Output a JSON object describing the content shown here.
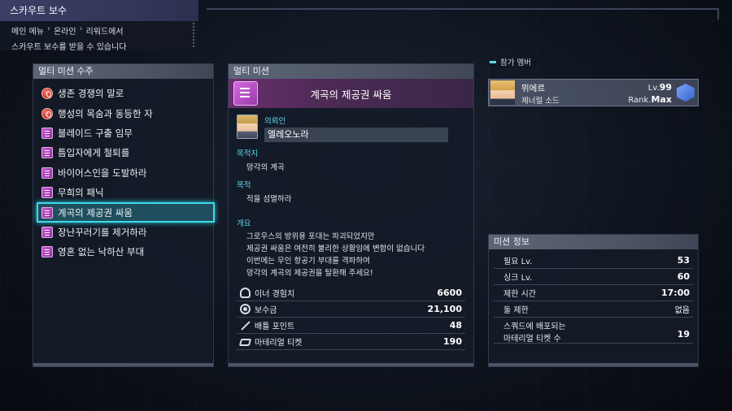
{
  "header": {
    "title": "스카우트 보수",
    "breadcrumb": [
      "메인 메뉴",
      "온라인",
      "리워드에서"
    ],
    "subtitle": "스카우트 보수를 받을 수 있습니다"
  },
  "left_panel": {
    "title": "멀티 미션 수주",
    "missions": [
      {
        "label": "생존 경쟁의 말로",
        "icon": "red-emblem-icon"
      },
      {
        "label": "행성의 목숨과 동등한 자",
        "icon": "red-emblem-icon"
      },
      {
        "label": "블레이드 구출 임무",
        "icon": "mission-doc-icon"
      },
      {
        "label": "틈입자에게 철퇴를",
        "icon": "mission-doc-icon"
      },
      {
        "label": "바이어스인을 도발하라",
        "icon": "mission-doc-icon"
      },
      {
        "label": "무희의 패닉",
        "icon": "mission-doc-icon"
      },
      {
        "label": "계곡의 제공권 싸움",
        "icon": "mission-doc-icon",
        "selected": true
      },
      {
        "label": "장난꾸러기를 제거하라",
        "icon": "mission-doc-icon"
      },
      {
        "label": "영혼 없는 낙하산 부대",
        "icon": "mission-doc-icon"
      }
    ]
  },
  "center_panel": {
    "title": "멀티 미션",
    "mission_title": "계곡의 제공권 싸움",
    "client_label": "의뢰인",
    "client_name": "엘레오노라",
    "destination_label": "목적지",
    "destination": "망각의 계곡",
    "objective_label": "목적",
    "objective": "적을 섬멸하라",
    "overview_label": "개요",
    "overview_lines": [
      "그로우스의 방위용 포대는 파괴되었지만",
      "제공권 싸움은 여전히 불리한 상황임에 변함이 없습니다",
      "이번에는 무인 항공기 부대를 격파하여",
      "망각의 계곡의 제공권을 탈환해 주세요!"
    ],
    "rewards": [
      {
        "icon": "exp-icon",
        "label": "이너 경험치",
        "value": "6600"
      },
      {
        "icon": "coin-icon",
        "label": "보수금",
        "value": "21,100"
      },
      {
        "icon": "battle-points-icon",
        "label": "배틀 포인트",
        "value": "48"
      },
      {
        "icon": "ticket-icon",
        "label": "마테리얼 티켓",
        "value": "190"
      }
    ]
  },
  "party": {
    "label": "참가 멤버",
    "member": {
      "name": "뮈에르",
      "class": "제너럴 소드",
      "level_label": "Lv.",
      "level": "99",
      "rank_label": "Rank.",
      "rank": "Max"
    }
  },
  "mission_info": {
    "title": "미션 정보",
    "rows": [
      {
        "label": "필요 Lv.",
        "value": "53"
      },
      {
        "label": "싱크 Lv.",
        "value": "60"
      },
      {
        "label": "제한 시간",
        "value": "17:00"
      },
      {
        "label": "둘 제한",
        "value": "없음"
      },
      {
        "label_line1": "스쿼드에 배포되는",
        "label_line2": "마테리얼 티켓 수",
        "value": "19"
      }
    ]
  },
  "colors": {
    "accent_cyan": "#3fd9e6",
    "mission_banner": "#6a2f6e",
    "header_title_bg": "#3b3f66"
  }
}
